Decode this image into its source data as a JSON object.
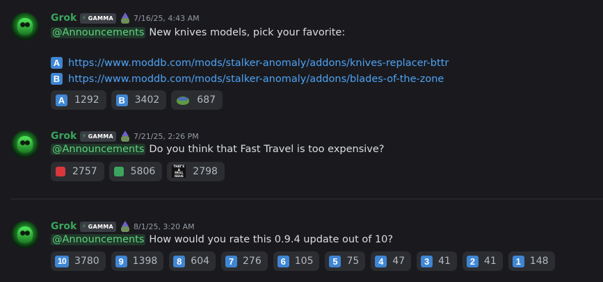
{
  "colors": {
    "background": "#1a1a1e",
    "author": "#3ba55d",
    "mention": "#5dd47c",
    "link": "#4ea3f5",
    "reaction_bg": "#2b2d31",
    "keycap": "#3f86d4",
    "red_square": "#da373c",
    "green_square": "#3ba55d"
  },
  "messages": [
    {
      "author": "Grok",
      "tag": "GAMMA",
      "timestamp": "7/16/25, 4:43 AM",
      "mention": "@Announcements",
      "text": "New knives models, pick your favorite:",
      "links": [
        {
          "emoji": "A",
          "url": "https://www.moddb.com/mods/stalker-anomaly/addons/knives-replacer-bttr"
        },
        {
          "emoji": "B",
          "url": "https://www.moddb.com/mods/stalker-anomaly/addons/blades-of-the-zone"
        }
      ],
      "reactions": [
        {
          "emoji": "A",
          "kind": "regional-indicator-a-icon",
          "count": "1292"
        },
        {
          "emoji": "B",
          "kind": "regional-indicator-b-icon",
          "count": "3402"
        },
        {
          "emoji": "",
          "kind": "frog-emoji-icon",
          "count": "687"
        }
      ]
    },
    {
      "author": "Grok",
      "tag": "GAMMA",
      "timestamp": "7/21/25, 2:26 PM",
      "mention": "@Announcements",
      "text": "Do you think that Fast Travel is too expensive?",
      "reactions": [
        {
          "kind": "red-square-icon",
          "count": "2757"
        },
        {
          "kind": "green-square-icon",
          "count": "5806"
        },
        {
          "kind": "thats-a-skill-issue-emoji-icon",
          "emoji_text": [
            "THAT'S",
            "A",
            "SKILL",
            "ISSUE"
          ],
          "count": "2798"
        }
      ]
    },
    {
      "author": "Grok",
      "tag": "GAMMA",
      "timestamp": "8/1/25, 3:20 AM",
      "mention": "@Announcements",
      "text": "How would you rate this 0.9.4 update out of 10?",
      "reactions": [
        {
          "emoji": "10",
          "count": "3780"
        },
        {
          "emoji": "9",
          "count": "1398"
        },
        {
          "emoji": "8",
          "count": "604"
        },
        {
          "emoji": "7",
          "count": "276"
        },
        {
          "emoji": "6",
          "count": "105"
        },
        {
          "emoji": "5",
          "count": "75"
        },
        {
          "emoji": "4",
          "count": "47"
        },
        {
          "emoji": "3",
          "count": "41"
        },
        {
          "emoji": "2",
          "count": "41"
        },
        {
          "emoji": "1",
          "count": "148"
        }
      ]
    }
  ]
}
